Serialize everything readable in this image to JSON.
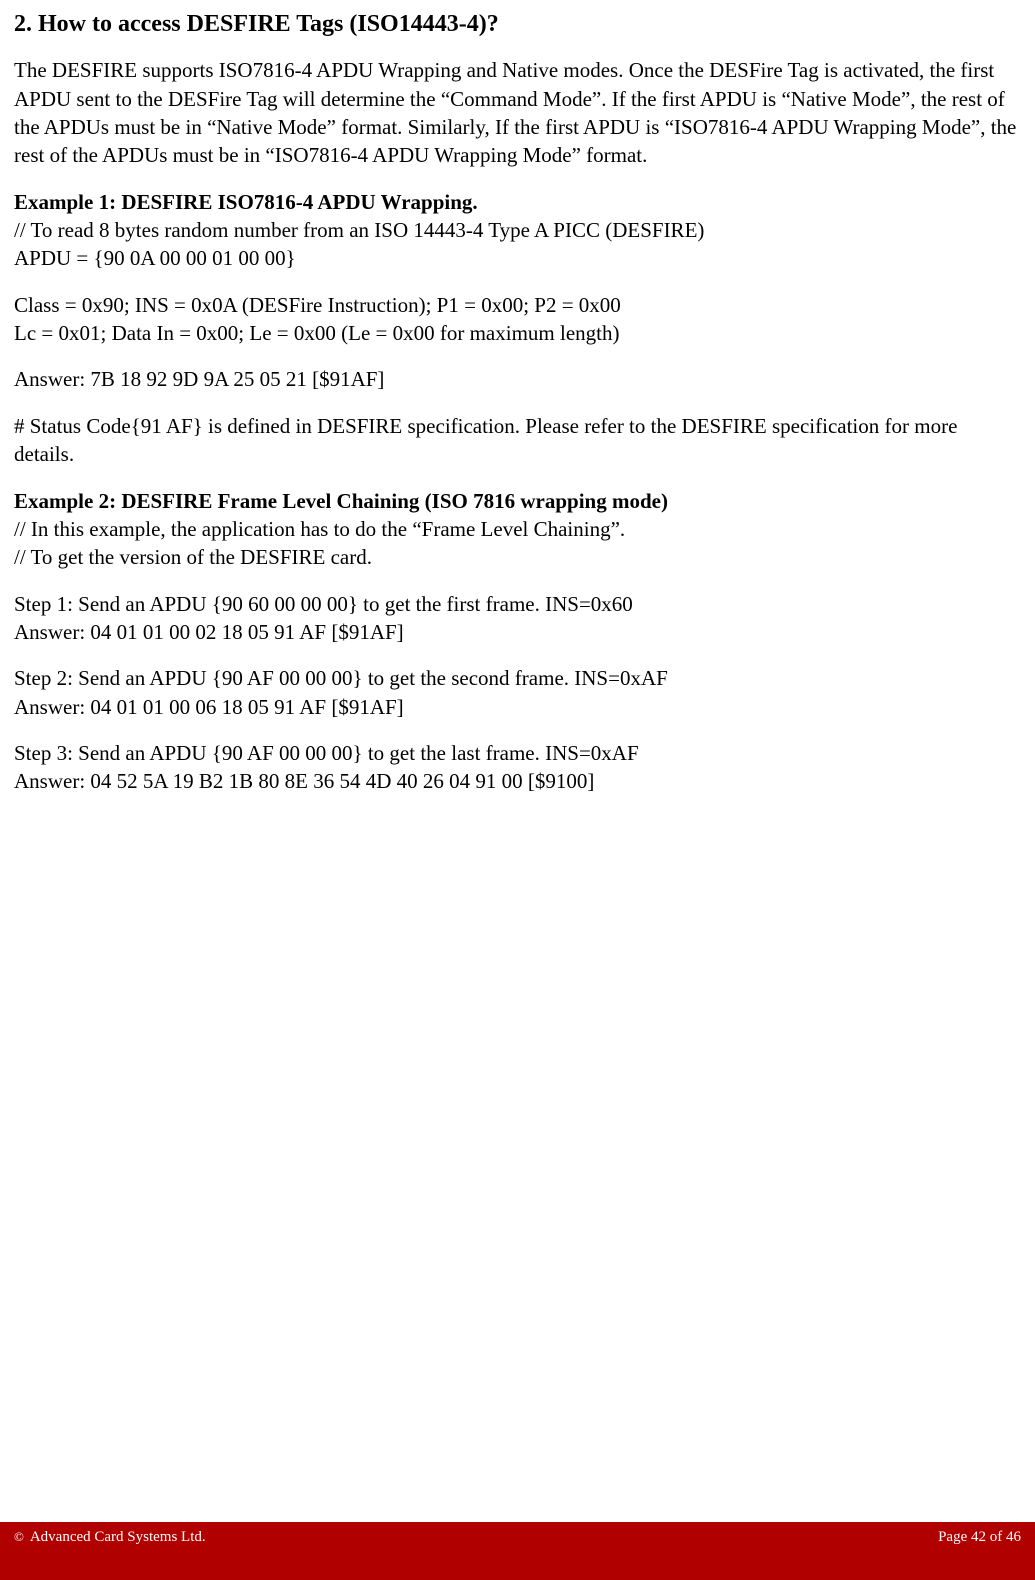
{
  "heading": "2. How to access DESFIRE Tags (ISO14443-4)?",
  "intro": "The DESFIRE supports ISO7816-4 APDU Wrapping and Native modes. Once the DESFire Tag is activated, the first APDU sent to the DESFire Tag will determine the “Command Mode”. If the first APDU is “Native Mode”, the rest of the APDUs must be in “Native Mode” format. Similarly, If the first APDU is “ISO7816-4 APDU Wrapping Mode”, the rest of the APDUs must be in “ISO7816-4 APDU Wrapping Mode” format.",
  "example1": {
    "title": "Example 1: DESFIRE ISO7816-4 APDU Wrapping.",
    "comment": "// To read 8 bytes random number from an ISO 14443-4 Type A PICC (DESFIRE)",
    "apdu": "APDU = {90 0A 00 00 01 00 00}",
    "params1": "Class = 0x90; INS = 0x0A (DESFire Instruction);  P1 = 0x00;  P2 = 0x00",
    "params2": "Lc = 0x01; Data In = 0x00; Le = 0x00 (Le = 0x00 for maximum length)",
    "answer": "Answer:  7B 18 92 9D 9A 25 05 21 [$91AF]",
    "note": "# Status Code{91 AF} is defined in DESFIRE specification. Please refer to the DESFIRE specification for more details."
  },
  "example2": {
    "title": "Example 2:  DESFIRE Frame Level Chaining (ISO 7816 wrapping mode)",
    "comment1": "// In this example, the application has to do the “Frame Level Chaining”.",
    "comment2": "// To get the version of the DESFIRE card.",
    "step1a": "Step 1: Send an APDU {90 60 00 00 00} to get the first frame. INS=0x60",
    "step1b": "Answer: 04 01 01 00 02 18 05 91 AF [$91AF]",
    "step2a": "Step 2: Send an APDU {90 AF 00 00 00} to get the second frame. INS=0xAF",
    "step2b": "Answer: 04 01 01 00 06 18 05 91 AF [$91AF]",
    "step3a": "Step 3: Send an APDU {90 AF 00 00 00} to get the last frame. INS=0xAF",
    "step3b": "Answer: 04 52 5A 19 B2 1B 80 8E 36 54 4D 40 26 04 91 00 [$9100]"
  },
  "footer": {
    "copyright": "Advanced Card Systems Ltd.",
    "page": "Page 42 of 46"
  }
}
